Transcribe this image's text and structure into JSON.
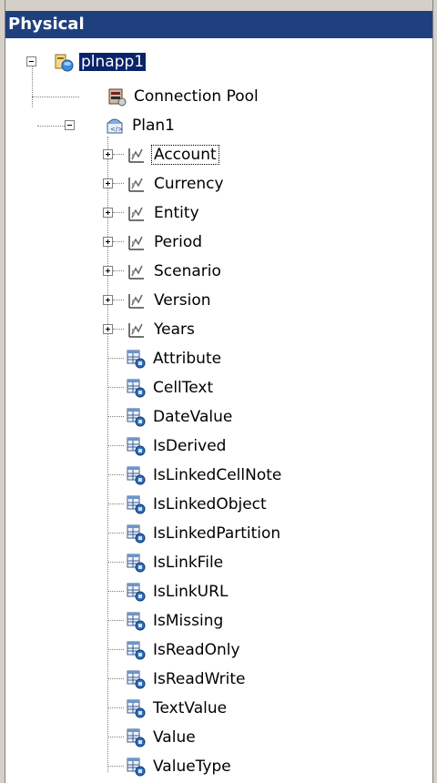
{
  "panel": {
    "title": "Physical"
  },
  "tree": {
    "root": {
      "label": "plnapp1",
      "icon": "database-app-icon"
    },
    "connection_pool": {
      "label": "Connection Pool",
      "icon": "connection-pool-icon"
    },
    "plan": {
      "label": "Plan1",
      "icon": "schema-icon"
    },
    "dimensions": [
      {
        "label": "Account",
        "icon": "dimension-icon"
      },
      {
        "label": "Currency",
        "icon": "dimension-icon"
      },
      {
        "label": "Entity",
        "icon": "dimension-icon"
      },
      {
        "label": "Period",
        "icon": "dimension-icon"
      },
      {
        "label": "Scenario",
        "icon": "dimension-icon"
      },
      {
        "label": "Version",
        "icon": "dimension-icon"
      },
      {
        "label": "Years",
        "icon": "dimension-icon"
      }
    ],
    "tables": [
      {
        "label": "Attribute",
        "icon": "table-icon"
      },
      {
        "label": "CellText",
        "icon": "table-icon"
      },
      {
        "label": "DateValue",
        "icon": "table-icon"
      },
      {
        "label": "IsDerived",
        "icon": "table-icon"
      },
      {
        "label": "IsLinkedCellNote",
        "icon": "table-icon"
      },
      {
        "label": "IsLinkedObject",
        "icon": "table-icon"
      },
      {
        "label": "IsLinkedPartition",
        "icon": "table-icon"
      },
      {
        "label": "IsLinkFile",
        "icon": "table-icon"
      },
      {
        "label": "IsLinkURL",
        "icon": "table-icon"
      },
      {
        "label": "IsMissing",
        "icon": "table-icon"
      },
      {
        "label": "IsReadOnly",
        "icon": "table-icon"
      },
      {
        "label": "IsReadWrite",
        "icon": "table-icon"
      },
      {
        "label": "TextValue",
        "icon": "table-icon"
      },
      {
        "label": "Value",
        "icon": "table-icon"
      },
      {
        "label": "ValueType",
        "icon": "table-icon"
      }
    ]
  },
  "colors": {
    "header_bg": "#1f3f7f",
    "selection_bg": "#0a246a"
  }
}
